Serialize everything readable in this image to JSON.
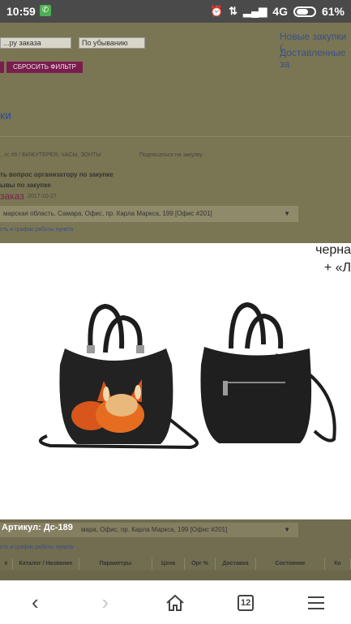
{
  "status": {
    "time": "10:59",
    "network": "4G",
    "battery": "61%"
  },
  "bg": {
    "sort_select1": "...ру заказа",
    "sort_select2": "По убыванию",
    "link1": "Новые закупки (",
    "link2": "Доставленные за",
    "reset_button": "СБРОСИТЬ ФИЛЬТР",
    "heading": "ки",
    "breadcrumb": "...rc #6 / БИЖУТЕРЕЯ, ЧАСЫ, ЗОНТЫ",
    "subscribe": "Подписаться на закупку",
    "ask_question": "ть вопрос организатору по закупке",
    "rules": "ывы по закупке",
    "order_label": "заказ",
    "order_date": "2017-10-27",
    "pickup_address": "марская область, Самара, Офис, пр. Карла Маркса, 199 [Офис #201]",
    "pickup_hint": "сть и график работы пункта"
  },
  "photo": {
    "caption_line1": "черна",
    "caption_line2": "+ «Л"
  },
  "bottom": {
    "article_label": "Артикул:",
    "article_value": "Дс-189",
    "address_tail": "мара, Офис, пр. Карла Маркса, 199 [Офис #201]",
    "hint": "сть и график работы пункта",
    "columns": [
      "е",
      "Каталог / Название",
      "Параметры",
      "Цена",
      "Орг %",
      "Доставка",
      "Состояние",
      "Ко"
    ]
  },
  "nav": {
    "tabs_count": "12"
  },
  "colors": {
    "status_bar": "#4a4a4a",
    "dim_overlay": "#7a7653",
    "accent_purple": "#7a1d4e",
    "link_blue": "#2e4a9e",
    "fox_orange": "#d8561b",
    "bag_black": "#1d1d1d"
  }
}
